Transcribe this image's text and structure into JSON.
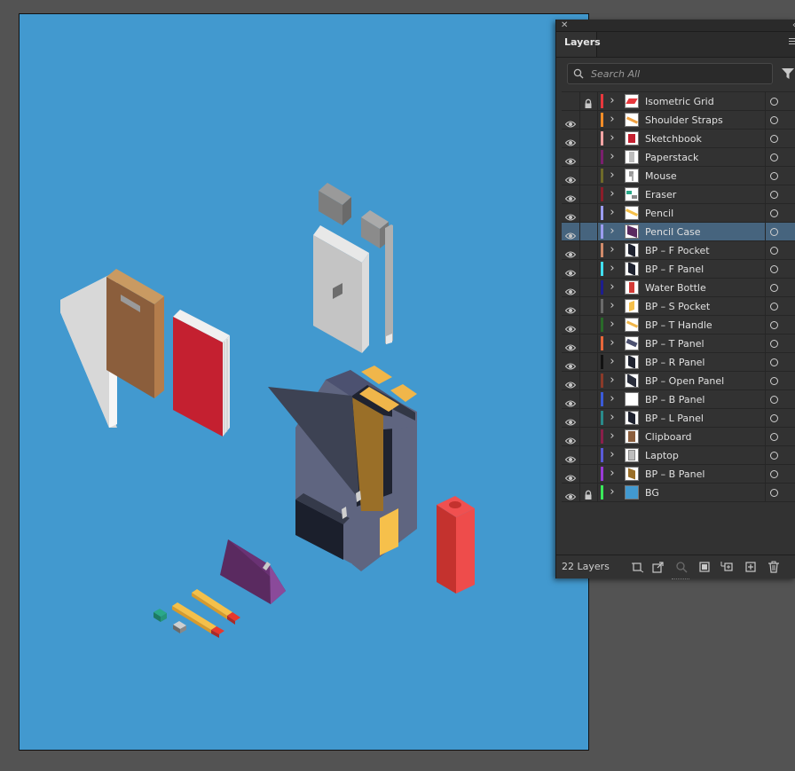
{
  "layers_panel": {
    "tab_label": "Layers",
    "search_placeholder": "Search All",
    "layer_count": "22 Layers",
    "layers": [
      {
        "name": "Isometric Grid",
        "color": "#e8383d",
        "visible": false,
        "locked": true,
        "selected": false,
        "thumb": "grid-thumb"
      },
      {
        "name": "Shoulder Straps",
        "color": "#f28c28",
        "visible": true,
        "locked": false,
        "selected": false,
        "thumb": "straps-thumb"
      },
      {
        "name": "Sketchbook",
        "color": "#f4a4a4",
        "visible": true,
        "locked": false,
        "selected": false,
        "thumb": "sketchbook-thumb"
      },
      {
        "name": "Paperstack",
        "color": "#7a1f6e",
        "visible": true,
        "locked": false,
        "selected": false,
        "thumb": "paperstack-thumb"
      },
      {
        "name": "Mouse",
        "color": "#6e6a2a",
        "visible": true,
        "locked": false,
        "selected": false,
        "thumb": "mouse-thumb"
      },
      {
        "name": "Eraser",
        "color": "#8a1d2a",
        "visible": true,
        "locked": false,
        "selected": false,
        "thumb": "eraser-thumb"
      },
      {
        "name": "Pencil",
        "color": "#9b9cf0",
        "visible": true,
        "locked": false,
        "selected": false,
        "thumb": "pencil-thumb"
      },
      {
        "name": "Pencil Case",
        "color": "#9b9cf0",
        "visible": true,
        "locked": false,
        "selected": true,
        "thumb": "pencil-case-thumb"
      },
      {
        "name": "BP – F Pocket",
        "color": "#d08a6a",
        "visible": true,
        "locked": false,
        "selected": false,
        "thumb": "dark-panel-thumb"
      },
      {
        "name": "BP – F Panel",
        "color": "#41e0f0",
        "visible": true,
        "locked": false,
        "selected": false,
        "thumb": "dark-panel-thumb"
      },
      {
        "name": "Water Bottle",
        "color": "#1d1d8f",
        "visible": true,
        "locked": false,
        "selected": false,
        "thumb": "bottle-thumb"
      },
      {
        "name": "BP – S Pocket",
        "color": "#6a6a6a",
        "visible": true,
        "locked": false,
        "selected": false,
        "thumb": "yellow-thumb"
      },
      {
        "name": "BP – T Handle",
        "color": "#2a6a2a",
        "visible": true,
        "locked": false,
        "selected": false,
        "thumb": "handle-thumb"
      },
      {
        "name": "BP – T Panel",
        "color": "#e8673a",
        "visible": true,
        "locked": false,
        "selected": false,
        "thumb": "slab-thumb"
      },
      {
        "name": "BP – R Panel",
        "color": "#111111",
        "visible": true,
        "locked": false,
        "selected": false,
        "thumb": "dark-panel-thumb"
      },
      {
        "name": "BP – Open Panel",
        "color": "#8a3a2a",
        "visible": true,
        "locked": false,
        "selected": false,
        "thumb": "open-panel-thumb"
      },
      {
        "name": "BP – B Panel",
        "color": "#3a5ad8",
        "visible": true,
        "locked": false,
        "selected": false,
        "thumb": "empty-thumb"
      },
      {
        "name": "BP – L Panel",
        "color": "#2a8a8a",
        "visible": true,
        "locked": false,
        "selected": false,
        "thumb": "dark-panel-thumb"
      },
      {
        "name": "Clipboard",
        "color": "#8a1f4a",
        "visible": true,
        "locked": false,
        "selected": false,
        "thumb": "clipboard-thumb"
      },
      {
        "name": "Laptop",
        "color": "#5a5ad8",
        "visible": true,
        "locked": false,
        "selected": false,
        "thumb": "laptop-thumb"
      },
      {
        "name": "BP – B Panel",
        "color": "#9a3ad8",
        "visible": true,
        "locked": false,
        "selected": false,
        "thumb": "brown-thumb"
      },
      {
        "name": "BG",
        "color": "#3ae85a",
        "visible": true,
        "locked": true,
        "selected": false,
        "thumb": "bg-thumb"
      }
    ]
  },
  "colors": {
    "workspace": "#535353",
    "artboard": "#4299cf",
    "panel": "#323232",
    "selection": "#46647e"
  }
}
